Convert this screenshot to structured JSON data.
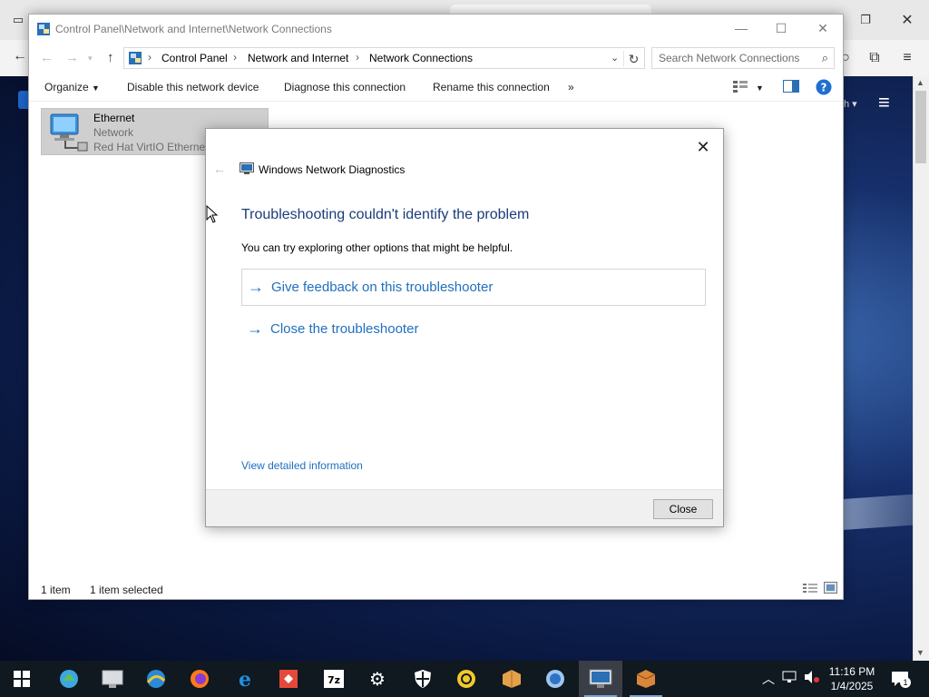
{
  "explorer": {
    "title": "Control Panel\\Network and Internet\\Network Connections",
    "breadcrumb": [
      "Control Panel",
      "Network and Internet",
      "Network Connections"
    ],
    "search_placeholder": "Search Network Connections",
    "commands": {
      "organize": "Organize",
      "disable": "Disable this network device",
      "diagnose": "Diagnose this connection",
      "rename": "Rename this connection",
      "more": "»"
    },
    "item": {
      "name": "Ethernet",
      "status": "Network",
      "device": "Red Hat VirtIO Ethernet"
    },
    "status": {
      "count": "1 item",
      "selected": "1 item selected"
    }
  },
  "dialog": {
    "app_title": "Windows Network Diagnostics",
    "heading": "Troubleshooting couldn't identify the problem",
    "subtext": "You can try exploring other options that might be helpful.",
    "options": [
      {
        "label": "Give feedback on this troubleshooter"
      },
      {
        "label": "Close the troubleshooter"
      }
    ],
    "detail_link": "View detailed information",
    "close_button": "Close"
  },
  "taskbar": {
    "time": "11:16 PM",
    "date": "1/4/2025",
    "notification_count": "1",
    "apps": [
      "start-icon",
      "network-app-icon",
      "server-manager-icon",
      "ie-globe-icon",
      "firefox-icon",
      "edge-legacy-icon",
      "git-icon",
      "seven-zip-icon",
      "settings-icon",
      "defender-shield-icon",
      "remote-desktop-icon",
      "package-icon",
      "browser-globe-icon",
      "network-connections-icon",
      "package-box-icon"
    ]
  },
  "colors": {
    "link_blue": "#1f6fbe",
    "heading_blue": "#1a3c7a",
    "selection_gray": "#cfcfcf"
  }
}
